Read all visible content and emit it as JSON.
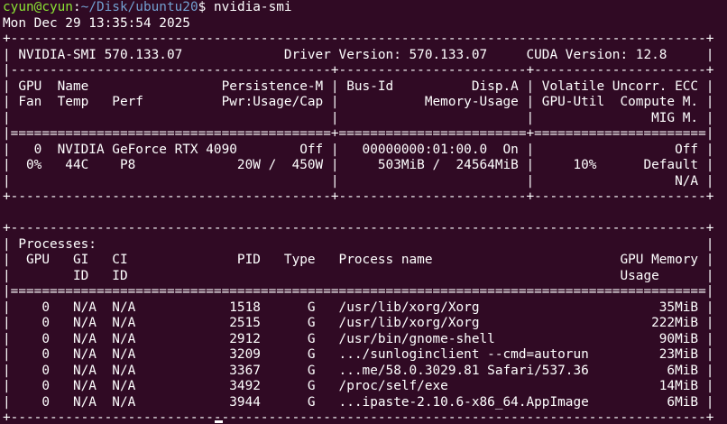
{
  "prompt": {
    "user_host": "cyun@cyun",
    "separator": ":",
    "path": "~/Disk/ubuntu20",
    "dollar": "$ ",
    "command": "nvidia-smi"
  },
  "output_lines": [
    "Mon Dec 29 13:35:54 2025",
    "+-----------------------------------------------------------------------------------------+",
    "| NVIDIA-SMI 570.133.07             Driver Version: 570.133.07     CUDA Version: 12.8     |",
    "|-----------------------------------------+------------------------+----------------------+",
    "| GPU  Name                 Persistence-M | Bus-Id          Disp.A | Volatile Uncorr. ECC |",
    "| Fan  Temp   Perf          Pwr:Usage/Cap |           Memory-Usage | GPU-Util  Compute M. |",
    "|                                         |                        |               MIG M. |",
    "|=========================================+========================+======================|",
    "|   0  NVIDIA GeForce RTX 4090        Off |   00000000:01:00.0  On |                  Off |",
    "|  0%   44C    P8             20W /  450W |     503MiB /  24564MiB |     10%      Default |",
    "|                                         |                        |                  N/A |",
    "+-----------------------------------------+------------------------+----------------------+",
    "",
    "+-----------------------------------------------------------------------------------------+",
    "| Processes:                                                                              |",
    "|  GPU   GI   CI              PID   Type   Process name                        GPU Memory |",
    "|        ID   ID                                                               Usage      |",
    "|=========================================================================================|",
    "|    0   N/A  N/A            1518      G   /usr/lib/xorg/Xorg                       35MiB |",
    "|    0   N/A  N/A            2515      G   /usr/lib/xorg/Xorg                      222MiB |",
    "|    0   N/A  N/A            2912      G   /usr/bin/gnome-shell                     90MiB |",
    "|    0   N/A  N/A            3209      G   .../sunloginclient --cmd=autorun         23MiB |",
    "|    0   N/A  N/A            3367      G   ...me/58.0.3029.81 Safari/537.36          6MiB |",
    "|    0   N/A  N/A            3492      G   /proc/self/exe                           14MiB |",
    "|    0   N/A  N/A            3944      G   ...ipaste-2.10.6-x86_64.AppImage          6MiB |",
    "+-----------------------------------------------------------------------------------------+"
  ]
}
